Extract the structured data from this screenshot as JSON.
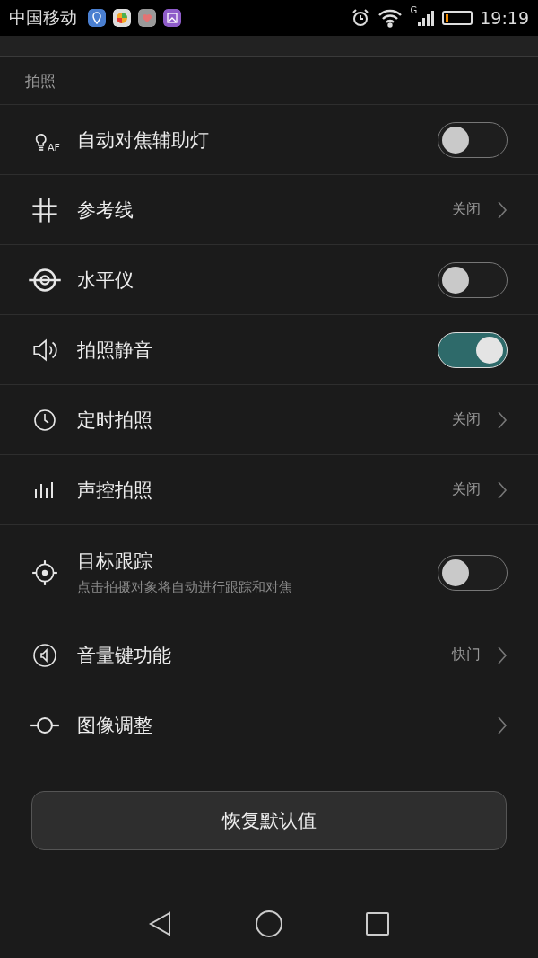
{
  "status_bar": {
    "carrier": "中国移动",
    "network": "G",
    "time": "19:19"
  },
  "section": {
    "title": "拍照"
  },
  "rows": [
    {
      "kind": "toggle",
      "icon_text": "AF",
      "label": "自动对焦辅助灯",
      "on": false
    },
    {
      "kind": "link",
      "label": "参考线",
      "value": "关闭"
    },
    {
      "kind": "toggle",
      "label": "水平仪",
      "on": false
    },
    {
      "kind": "toggle",
      "label": "拍照静音",
      "on": true
    },
    {
      "kind": "link",
      "label": "定时拍照",
      "value": "关闭"
    },
    {
      "kind": "link",
      "label": "声控拍照",
      "value": "关闭"
    },
    {
      "kind": "toggle",
      "label": "目标跟踪",
      "description": "点击拍摄对象将自动进行跟踪和对焦",
      "on": false
    },
    {
      "kind": "link",
      "label": "音量键功能",
      "value": "快门"
    },
    {
      "kind": "link",
      "label": "图像调整"
    }
  ],
  "reset_button": "恢复默认值"
}
